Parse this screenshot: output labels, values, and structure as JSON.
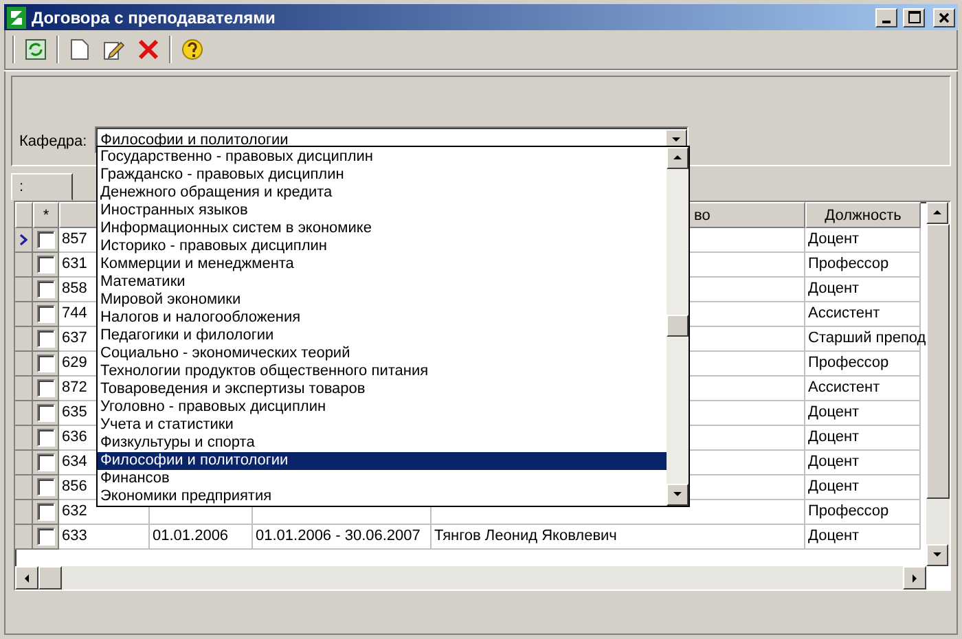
{
  "window": {
    "title": "Договора с преподавателями"
  },
  "filter": {
    "label": "Кафедра:",
    "value": "Философии и политологии",
    "expanded": true,
    "options": [
      {
        "label": "Государственно - правовых дисциплин",
        "selected": false
      },
      {
        "label": "Гражданско - правовых дисциплин",
        "selected": false
      },
      {
        "label": "Денежного обращения и кредита",
        "selected": false
      },
      {
        "label": "Иностранных языков",
        "selected": false
      },
      {
        "label": "Информационных систем в экономике",
        "selected": false
      },
      {
        "label": "Историко - правовых дисциплин",
        "selected": false
      },
      {
        "label": "Коммерции и менеджмента",
        "selected": false
      },
      {
        "label": "Математики",
        "selected": false
      },
      {
        "label": "Мировой экономики",
        "selected": false
      },
      {
        "label": "Налогов и налогообложения",
        "selected": false
      },
      {
        "label": "Педагогики и филологии",
        "selected": false
      },
      {
        "label": "Социально - экономических теорий",
        "selected": false
      },
      {
        "label": "Технологии продуктов общественного питания",
        "selected": false
      },
      {
        "label": "Товароведения и экспертизы товаров",
        "selected": false
      },
      {
        "label": "Уголовно - правовых дисциплин",
        "selected": false
      },
      {
        "label": "Учета и статистики",
        "selected": false
      },
      {
        "label": "Физкультуры и спорта",
        "selected": false
      },
      {
        "label": "Философии и политологии",
        "selected": true
      },
      {
        "label": "Финансов",
        "selected": false
      },
      {
        "label": "Экономики предприятия",
        "selected": false
      }
    ]
  },
  "tabs": [
    {
      "label": ":",
      "selected": true
    }
  ],
  "grid": {
    "columns": [
      "*",
      "",
      "",
      "",
      "во",
      "Должность"
    ],
    "rows": [
      {
        "current": true,
        "checked": false,
        "number": "857",
        "position": "Доцент"
      },
      {
        "current": false,
        "checked": false,
        "number": "631",
        "position": "Профессор"
      },
      {
        "current": false,
        "checked": false,
        "number": "858",
        "position": "Доцент"
      },
      {
        "current": false,
        "checked": false,
        "number": "744",
        "position": "Ассистент"
      },
      {
        "current": false,
        "checked": false,
        "number": "637",
        "position": "Старший препод"
      },
      {
        "current": false,
        "checked": false,
        "number": "629",
        "position": "Профессор"
      },
      {
        "current": false,
        "checked": false,
        "number": "872",
        "position": "Ассистент"
      },
      {
        "current": false,
        "checked": false,
        "number": "635",
        "position": "Доцент"
      },
      {
        "current": false,
        "checked": false,
        "number": "636",
        "position": "Доцент"
      },
      {
        "current": false,
        "checked": false,
        "number": "634",
        "position": "Доцент"
      },
      {
        "current": false,
        "checked": false,
        "number": "856",
        "position": "Доцент"
      },
      {
        "current": false,
        "checked": false,
        "number": "632",
        "position": "Профессор"
      },
      {
        "current": false,
        "checked": false,
        "number": "633",
        "date": "01.01.2006",
        "period": "01.01.2006 - 30.06.2007",
        "name": "Тянгов Леонид Яковлевич",
        "position": "Доцент"
      }
    ]
  }
}
